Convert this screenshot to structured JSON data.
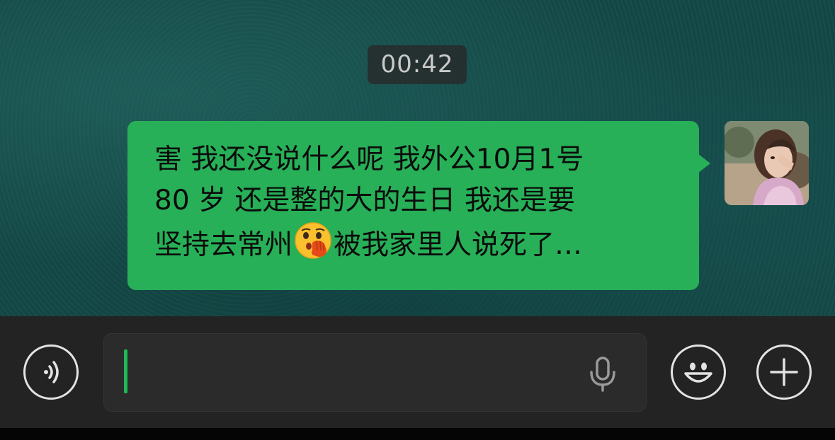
{
  "chat": {
    "timestamp": "00:42",
    "message": {
      "lines": [
        "害 我还没说什么呢 我外公10月1号",
        "80 岁 还是整的大的生日 我还是要",
        "坚持去常州",
        "被我家里人说死了…"
      ],
      "emoji": "face-with-hand-over-mouth-peeking"
    },
    "bubble_color": "#27b057"
  },
  "input_bar": {
    "value": "",
    "accent_color": "#1db954",
    "icons": [
      "voice-mode-icon",
      "microphone-icon",
      "emoji-smiley-icon",
      "plus-icon"
    ]
  }
}
